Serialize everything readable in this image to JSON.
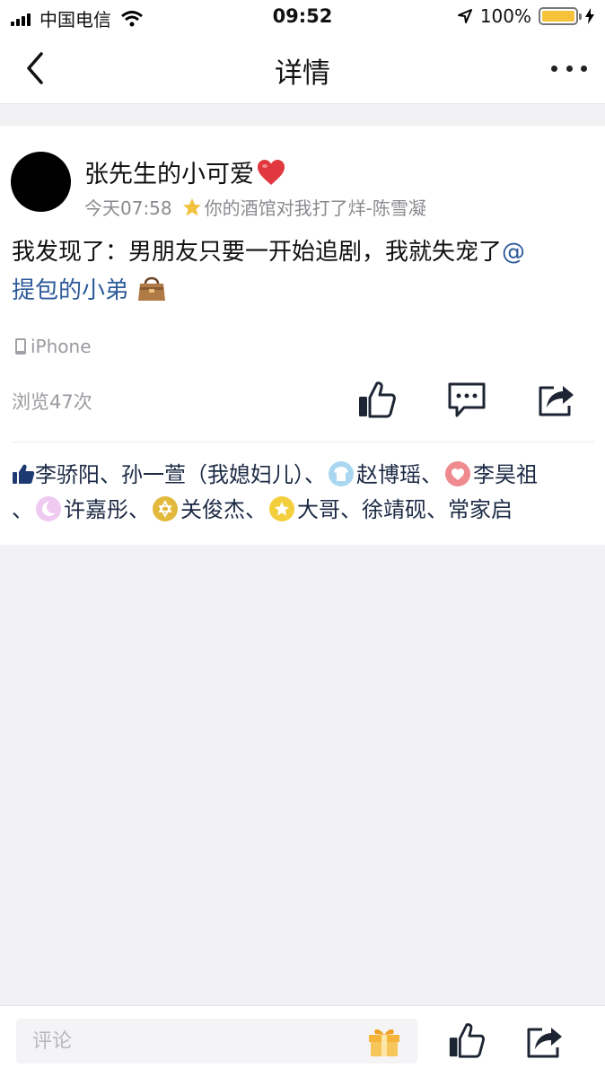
{
  "status_bar": {
    "carrier": "中国电信",
    "time": "09:52",
    "battery_text": "100%",
    "battery_level": 1.0
  },
  "nav": {
    "title": "详情"
  },
  "post": {
    "author": "张先生的小可爱",
    "time": "今天07:58",
    "signature": "你的酒馆对我打了烊-陈雪凝",
    "text": "我发现了：男朋友只要一开始追剧，我就失宠了",
    "mention_at": "@",
    "mention_name": "提包的小弟",
    "device": "iPhone",
    "views": "浏览47次"
  },
  "likes": {
    "l1": "李骄阳、孙一萱（我媳妇儿）、",
    "l2": "赵博瑶、",
    "l3": "李昊祖",
    "l4": "、",
    "l5": "许嘉彤、",
    "l6": "关俊杰、",
    "l7": "大哥、徐靖砚、常家启"
  },
  "bottom": {
    "comment_placeholder": "评论"
  },
  "colors": {
    "mention": "#2c5a9a",
    "accent_yellow": "#f5c23a",
    "heart": "#e0383e"
  }
}
